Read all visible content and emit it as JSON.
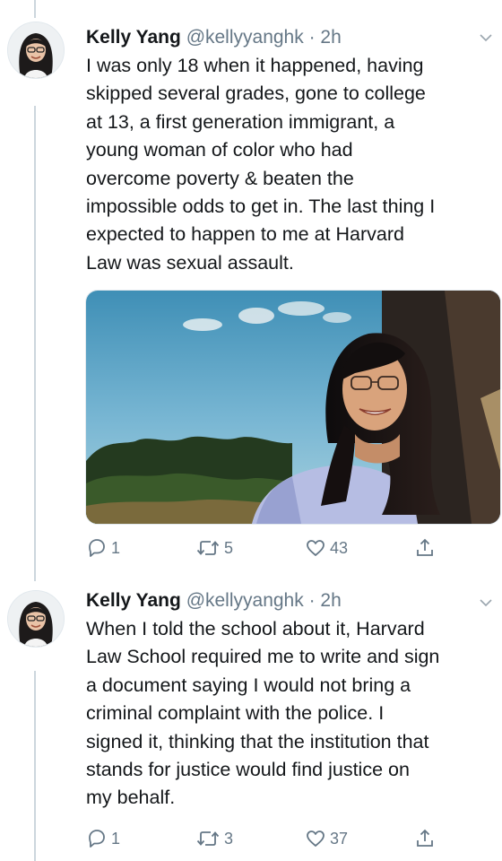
{
  "tweets": [
    {
      "name": "Kelly Yang",
      "handle": "@kellyyanghk",
      "dot": "·",
      "time": "2h",
      "lines": [
        "I was only 18 when it happened, having",
        "skipped several grades, gone to college",
        "at 13, a first generation immigrant, a",
        "young woman of color who had",
        "overcome poverty & beaten the",
        "impossible odds to get in. The last thing I",
        "expected to happen to me at Harvard",
        "Law was sexual assault."
      ],
      "has_media": true,
      "replies": "1",
      "retweets": "5",
      "likes": "43"
    },
    {
      "name": "Kelly Yang",
      "handle": "@kellyyanghk",
      "dot": "·",
      "time": "2h",
      "lines": [
        "When I told the school about it, Harvard",
        "Law School required me to write and sign",
        "a document saying I would not bring a",
        "criminal complaint with the police. I",
        "signed it, thinking that the institution that",
        "stands for justice would find justice on",
        "my behalf."
      ],
      "has_media": false,
      "replies": "1",
      "retweets": "3",
      "likes": "37"
    }
  ],
  "icons": {
    "reply": "reply-icon",
    "retweet": "retweet-icon",
    "like": "like-icon",
    "share": "share-icon",
    "caret": "chevron-down-icon"
  },
  "colors": {
    "text": "#14171a",
    "secondary": "#657786",
    "thread_line": "#ccd6dd"
  }
}
